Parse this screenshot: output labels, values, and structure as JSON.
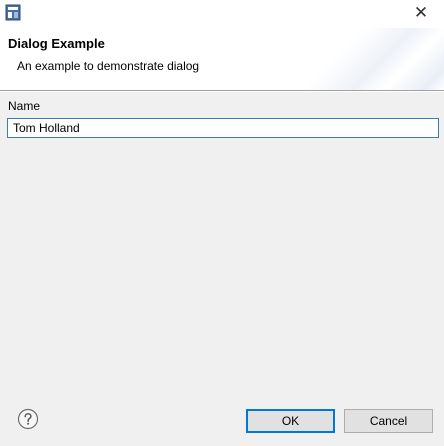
{
  "window": {
    "close_symbol": "✕",
    "app_icon": "eclipse-window-icon"
  },
  "header": {
    "title": "Dialog Example",
    "description": "An example to demonstrate dialog"
  },
  "form": {
    "name_label": "Name",
    "name_value": "Tom Holland"
  },
  "buttons": {
    "help_icon": "help-question-icon",
    "ok_label": "OK",
    "cancel_label": "Cancel"
  },
  "colors": {
    "background": "#f0f0f0",
    "header_background": "#ffffff",
    "focus_border": "#3d7ab8",
    "default_button_border": "#0078d7"
  }
}
